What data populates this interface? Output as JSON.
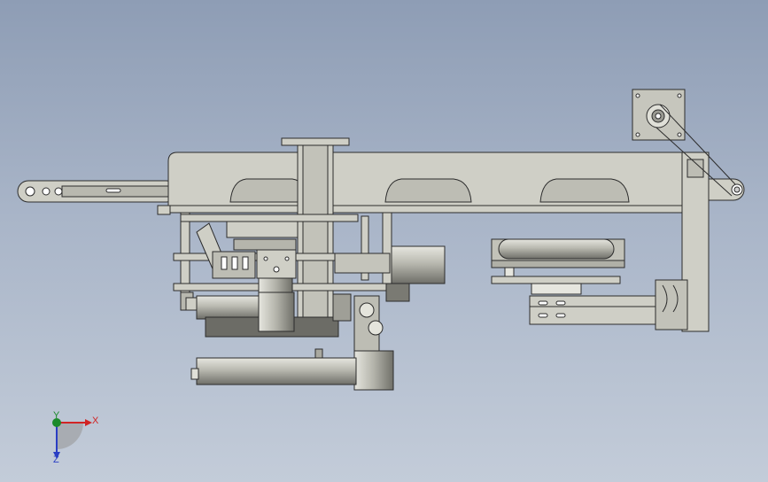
{
  "view": {
    "background_top": "#8e9db5",
    "background_bottom": "#c3ccd9",
    "model_fill": "#cfcfc6",
    "model_fill_dark": "#a9a9a0",
    "model_edge": "#2c2c2c"
  },
  "triad": {
    "x_label": "X",
    "y_label": "Y",
    "z_label": "Z",
    "x_color": "#d12424",
    "y_color": "#1b8a2a",
    "z_color": "#2a3ec4"
  }
}
